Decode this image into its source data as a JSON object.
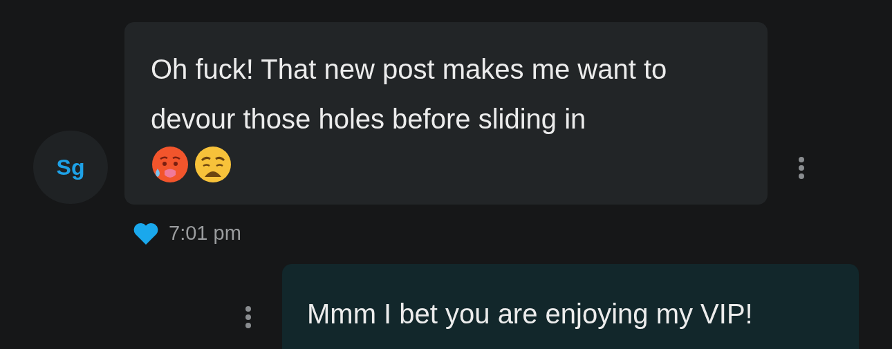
{
  "messages": [
    {
      "kind": "received",
      "avatar": "Sg",
      "text": "Oh fuck! That new post makes me want to devour those holes before sliding in",
      "emojis": [
        {
          "kind": "hot"
        },
        {
          "kind": "weary"
        }
      ],
      "liked": true,
      "time": "7:01 pm"
    },
    {
      "kind": "sent",
      "text": "Mmm I bet you are enjoying my VIP!"
    }
  ]
}
